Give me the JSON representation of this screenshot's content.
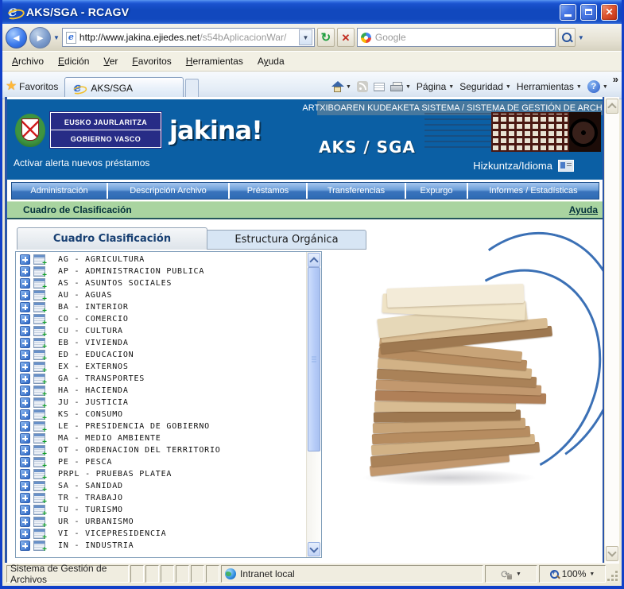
{
  "window": {
    "title": "AKS/SGA - RCAGV"
  },
  "address_bar": {
    "url_host": "http://www.jakina.ejiedes.net",
    "url_path": "/s54bAplicacionWar/",
    "search_placeholder": "Google"
  },
  "menu_bar": {
    "items": [
      {
        "pre": "",
        "key": "A",
        "post": "rchivo"
      },
      {
        "pre": "",
        "key": "E",
        "post": "dición"
      },
      {
        "pre": "",
        "key": "V",
        "post": "er"
      },
      {
        "pre": "",
        "key": "F",
        "post": "avoritos"
      },
      {
        "pre": "",
        "key": "H",
        "post": "erramientas"
      },
      {
        "pre": "A",
        "key": "y",
        "post": "uda"
      }
    ]
  },
  "favorites_bar": {
    "favorites_label": "Favoritos",
    "tab_label": "AKS/SGA",
    "page_label": "Página",
    "security_label": "Seguridad",
    "tools_label": "Herramientas",
    "overflow_label": "»"
  },
  "header": {
    "system_line": "ARTXIBOAREN KUDEAKETA SISTEMA / SISTEMA DE GESTIÓN DE ARCHIVO",
    "app_name": "AKS / SGA",
    "brand": "jakina!",
    "gov_line1": "EUSKO JAURLARITZA",
    "gov_line2": "GOBIERNO VASCO",
    "alert_link": "Activar alerta nuevos préstamos",
    "language_label": "Hizkuntza/Idioma"
  },
  "nav": {
    "items": [
      "Administración",
      "Descripción Archivo",
      "Préstamos",
      "Transferencias",
      "Expurgo",
      "Informes / Estadísticas"
    ]
  },
  "page_header": {
    "title": "Cuadro de Clasificación",
    "help_link": "Ayuda"
  },
  "tabs": {
    "classification": "Cuadro Clasificación",
    "organic": "Estructura Orgánica"
  },
  "tree": {
    "items": [
      "AG - AGRICULTURA",
      "AP - ADMINISTRACION PUBLICA",
      "AS - ASUNTOS SOCIALES",
      "AU - AGUAS",
      "BA - INTERIOR",
      "CO - COMERCIO",
      "CU - CULTURA",
      "EB - VIVIENDA",
      "ED - EDUCACION",
      "EX - EXTERNOS",
      "GA - TRANSPORTES",
      "HA - HACIENDA",
      "JU - JUSTICIA",
      "KS - CONSUMO",
      "LE - PRESIDENCIA DE GOBIERNO",
      "MA - MEDIO AMBIENTE",
      "OT - ORDENACION DEL TERRITORIO",
      "PE - PESCA",
      "PRPL - PRUEBAS PLATEA",
      "SA - SANIDAD",
      "TR - TRABAJO",
      "TU - TURISMO",
      "UR - URBANISMO",
      "VI - VICEPRESIDENCIA",
      "IN - INDUSTRIA"
    ]
  },
  "status_bar": {
    "left_text": "Sistema de Gestión de Archivos",
    "zone_label": "Intranet local",
    "zoom_level": "100%"
  },
  "colors": {
    "header_blue": "#0B5FA4",
    "nav_button_blue": "#3A74BC",
    "green_bar": "#A9D4A0",
    "titlebar_blue": "#1148BE",
    "arc_blue": "#3B70B5"
  }
}
